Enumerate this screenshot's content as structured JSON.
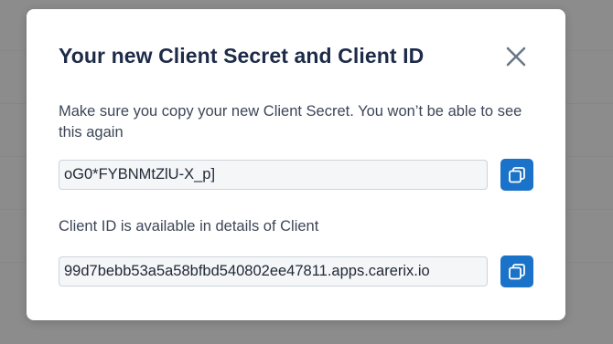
{
  "modal": {
    "title": "Your new Client Secret and Client ID",
    "description": "Make sure you copy your new Client Secret. You won’t be able to see this again",
    "secret_value": "oG0*FYBNMtZlU-X_p]",
    "client_id_info": "Client ID is available in details of Client",
    "client_id_value": "99d7bebb53a5a58bfbd540802ee47811.apps.carerix.io"
  },
  "icons": {
    "close": "close-icon",
    "copy": "copy-icon"
  },
  "colors": {
    "overlay": "#8c8c8c",
    "title": "#1d2b48",
    "accent": "#1a73c8",
    "close_icon": "#6b7787"
  }
}
